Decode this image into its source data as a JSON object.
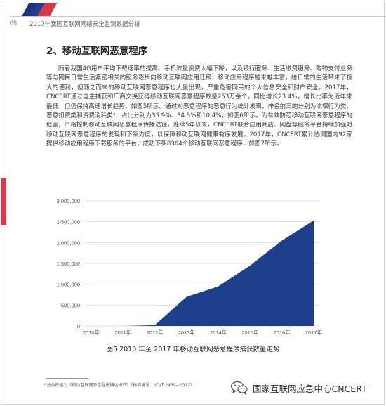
{
  "header": {
    "page_number": "05",
    "title": "2017年我国互联网网络安全监测数据分析"
  },
  "section": {
    "heading": "2、移动互联网恶意程序"
  },
  "body": {
    "paragraph": "随着我国4G用户平均下载速率的提高、手机流量资费大幅下降，以及银行服务、生活缴费服务、购物支付业务等与网民日常生活紧密相关的服务逐步向移动互联网应用迁移，移动应用程序越来越丰富，给日常的生活带来了极大的便利，但随之而来的移动互联网恶意程序也大量出现，严重危害网民的个人信息安全和财产安全。2017年，CNCERT通过自主捕获和厂商交换获得移动互联网恶意程序数量253万余个，同比增长23.4%，增长比率为近年来最低，但仍保持高速增长趋势，如图5所示。通过对恶意程序的恶意行为统计发现，排名前三的分别为流氓行为类、恶意扣费类和资费消耗类⁴，占比分别为35.9%、34.3%和10.4%，如图6所示。为有效防范移动互联网恶意程序的危害，严格控制移动互联网恶意程序传播途径，连续5年以来，CNCERT联合应用商店、网盘等服务平台持续加强对移动互联网恶意程序的发现和下架力度，以保障移动互联网健康有序发展。2017年，CNCERT累计协调国内92家提供移动应用程序下载服务的平台，成功下架8364个移动互联网恶意程序，如图7所示。"
  },
  "chart_data": {
    "type": "area",
    "categories": [
      "2010年",
      "2011年",
      "2012年",
      "2013年",
      "2014年",
      "2015年",
      "2016年",
      "2017年"
    ],
    "values": [
      0,
      0,
      20000,
      700000,
      950000,
      1450000,
      2050000,
      2530000
    ],
    "yticks": [
      "0",
      "500,000",
      "1,000,000",
      "1,500,000",
      "2,000,000",
      "2,500,000",
      "3,000,000"
    ],
    "ylim": [
      0,
      3000000
    ],
    "grid": true,
    "color": "#1d3f8c",
    "title": "图5 2010 年至 2017 年移动互联网恶意程序捕获数量走势",
    "xlabel": "",
    "ylabel": ""
  },
  "footnote": "⁴ 分类依据为《移动互联网恶意程序描述格式》（标准编号：YD/T 2439−2012）",
  "watermark": {
    "icon": "wechat-icon",
    "text": "国家互联网应急中心CNCERT"
  }
}
